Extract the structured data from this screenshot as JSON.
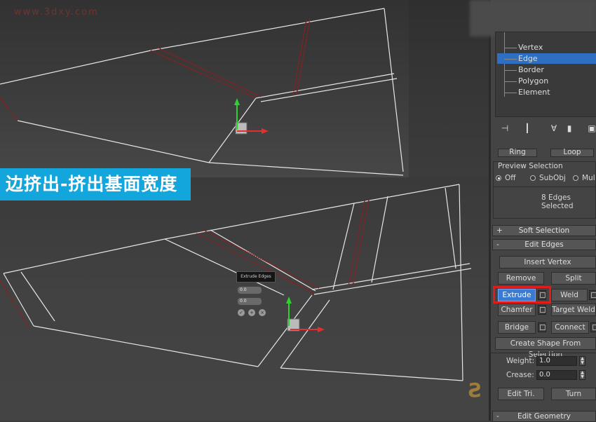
{
  "watermark": "www.3dxy.com",
  "caption": "边挤出-挤出基面宽度",
  "caddy": {
    "title": "Extrude Edges",
    "field_height": "0.0",
    "field_width": "0.0",
    "icons": [
      "check-icon",
      "plus-icon",
      "cancel-icon"
    ]
  },
  "modifier_tree": {
    "items": [
      "Vertex",
      "Edge",
      "Border",
      "Polygon",
      "Element"
    ],
    "selected": "Edge"
  },
  "selection": {
    "ring_label": "Ring",
    "loop_label": "Loop",
    "preview_title": "Preview Selection",
    "preview_options": [
      "Off",
      "SubObj",
      "Mul"
    ],
    "preview_selected": "Off",
    "status": "8 Edges Selected"
  },
  "rollouts": {
    "soft_selection": {
      "sign": "+",
      "label": "Soft Selection"
    },
    "edit_edges": {
      "sign": "-",
      "label": "Edit Edges"
    },
    "edit_geometry": {
      "sign": "-",
      "label": "Edit Geometry"
    }
  },
  "edit_edges": {
    "insert_vertex": "Insert Vertex",
    "remove": "Remove",
    "split": "Split",
    "extrude": "Extrude",
    "weld": "Weld",
    "chamfer": "Chamfer",
    "target_weld": "Target Weld",
    "bridge": "Bridge",
    "connect": "Connect",
    "create_shape": "Create Shape From Selection",
    "weight_label": "Weight:",
    "weight_value": "1.0",
    "crease_label": "Crease:",
    "crease_value": "0.0",
    "edit_tri": "Edit Tri.",
    "turn": "Turn"
  },
  "colors": {
    "accent_blue": "#13a6dd",
    "highlight_red": "#e01c1c",
    "selected_edge": "#8a2020"
  }
}
